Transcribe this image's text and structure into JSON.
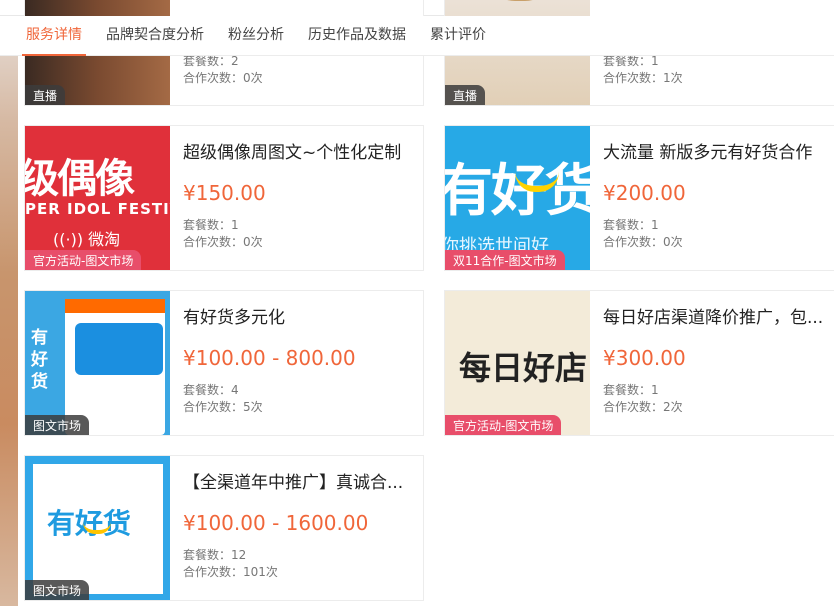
{
  "tabs": [
    {
      "label": "服务详情",
      "active": true
    },
    {
      "label": "品牌契合度分析"
    },
    {
      "label": "粉丝分析"
    },
    {
      "label": "历史作品及数据"
    },
    {
      "label": "累计评价"
    }
  ],
  "colors": {
    "accent": "#f0663a",
    "tag_pink": "#e84e6a",
    "tag_gray": "#3c3c3c"
  },
  "cards": [
    {
      "tag": "直播",
      "meta1": "套餐数：2",
      "meta2": "合作次数：0次"
    },
    {
      "tag": "直播",
      "meta1": "套餐数：1",
      "meta2": "合作次数：1次"
    },
    {
      "title": "超级偶像周图文~个性化定制",
      "price": "¥150.00",
      "meta1": "套餐数：1",
      "meta2": "合作次数：0次",
      "tag": "官方活动-图文市场",
      "thumb": {
        "big": "级偶像",
        "sub": "PER IDOL FESTIVA",
        "weibo": "微淘"
      }
    },
    {
      "title": "大流量 新版多元有好货合作",
      "price": "¥200.00",
      "meta1": "套餐数：1",
      "meta2": "合作次数：0次",
      "tag": "双11合作-图文市场",
      "thumb": {
        "big": "有好货",
        "script": "你挑选世间好"
      }
    },
    {
      "title": "有好货多元化",
      "price": "¥100.00 - 800.00",
      "meta1": "套餐数：4",
      "meta2": "合作次数：5次",
      "tag": "图文市场",
      "thumb": {
        "side": "有好货"
      }
    },
    {
      "title": "每日好店渠道降价推广，包...",
      "price": "¥300.00",
      "meta1": "套餐数：1",
      "meta2": "合作次数：2次",
      "tag": "官方活动-图文市场",
      "thumb": {
        "logo": "每日好店"
      }
    },
    {
      "title": "【全渠道年中推广】真诚合...",
      "price": "¥100.00 - 1600.00",
      "meta1": "套餐数：12",
      "meta2": "合作次数：101次",
      "tag": "图文市场",
      "thumb": {
        "logo": "有好货"
      }
    }
  ]
}
